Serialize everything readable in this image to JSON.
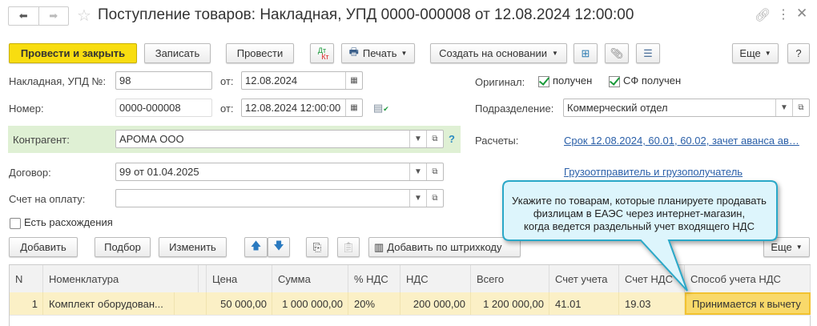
{
  "title": "Поступление товаров: Накладная, УПД 0000-000008 от 12.08.2024 12:00:00",
  "toolbar": {
    "post_close": "Провести и закрыть",
    "save": "Записать",
    "post": "Провести",
    "dtkt_dt": "Дт",
    "dtkt_kt": "Кт",
    "print": "Печать",
    "create_based": "Создать на основании",
    "more": "Еще",
    "help": "?"
  },
  "form": {
    "invoice_label": "Накладная, УПД №:",
    "invoice_value": "98",
    "from_label": "от:",
    "invoice_date": "12.08.2024",
    "number_label": "Номер:",
    "number_value": "0000-000008",
    "number_date": "12.08.2024 12:00:00",
    "counterparty_label": "Контрагент:",
    "counterparty_value": "АРОМА ООО",
    "help_q": "?",
    "contract_label": "Договор:",
    "contract_value": "99 от 01.04.2025",
    "payment_invoice_label": "Счет на оплату:",
    "payment_invoice_value": "",
    "discrepancies_label": "Есть расхождения",
    "original_label": "Оригинал:",
    "original_received": "получен",
    "sf_received": "СФ получен",
    "department_label": "Подразделение:",
    "department_value": "Коммерческий отдел",
    "settlements_label": "Расчеты:",
    "settlements_link": "Срок 12.08.2024, 60.01, 60.02, зачет аванса ав…",
    "shipper_link": "Грузоотправитель и грузополучатель"
  },
  "table_toolbar": {
    "add": "Добавить",
    "pick": "Подбор",
    "edit": "Изменить",
    "barcode": "Добавить по штрихкоду",
    "more": "Еще"
  },
  "table": {
    "headers": [
      "N",
      "Номенклатура",
      "",
      "Цена",
      "Сумма",
      "% НДС",
      "НДС",
      "Всего",
      "Счет учета",
      "Счет НДС",
      "Способ учета НДС"
    ],
    "rows": [
      [
        "1",
        "Комплект оборудован...",
        "",
        "50 000,00",
        "1 000 000,00",
        "20%",
        "200 000,00",
        "1 200 000,00",
        "41.01",
        "19.03",
        "Принимается к вычету"
      ]
    ]
  },
  "tooltip": {
    "line1": "Укажите по товарам, которые планируете продавать",
    "line2": "физлицам в ЕАЭС через интернет-магазин,",
    "line3": "когда ведется раздельный учет входящего НДС"
  }
}
